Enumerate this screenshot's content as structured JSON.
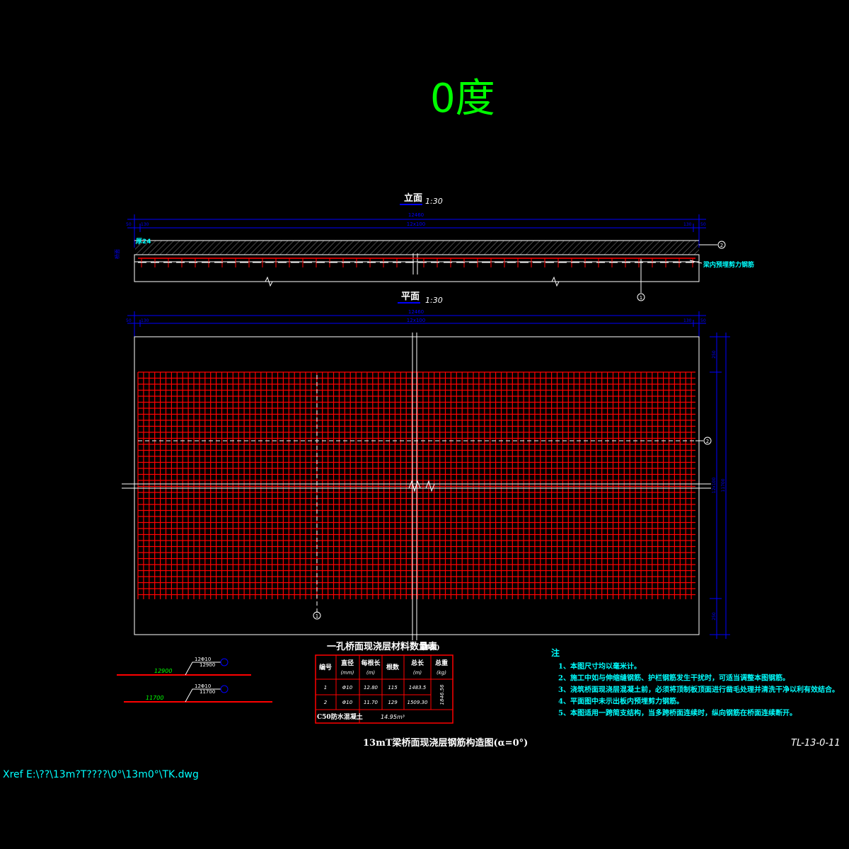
{
  "title": "0度",
  "elevation": {
    "label": "立面",
    "scale": "1:30",
    "dim_total": "12460",
    "dim_left": "50",
    "dim_left2": "130",
    "dim_mid": "12x100",
    "dim_right2": "130",
    "dim_right": "50",
    "thickness_label": "厚24",
    "side_label": "桥面",
    "rebar_note": "梁内预埋剪力钢筋",
    "marker1": "1",
    "marker2": "2"
  },
  "plan": {
    "label": "平面",
    "scale": "1:30",
    "dim_total": "12460",
    "dim_left": "50",
    "dim_left2": "130",
    "dim_mid": "12x100",
    "dim_right2": "130",
    "dim_right": "50",
    "dim_v_top": "250",
    "dim_v_mid": "12x100",
    "dim_v_mid2": "11700",
    "dim_v_bot": "250",
    "marker1": "1",
    "marker2": "2"
  },
  "bars": {
    "bar2_length": "12900",
    "bar2_text_a": "12Φ10",
    "bar2_text_b": "12900",
    "bar1_length": "11700",
    "bar1_text_a": "12Φ10",
    "bar1_text_b": "11700"
  },
  "table": {
    "title": "一孔桥面现浇层材料数量表",
    "title_note": "(单幅)",
    "headers": [
      "编号",
      "直径\n(mm)",
      "每根长\n(m)",
      "根数",
      "总长\n(m)",
      "总重\n(kg)"
    ],
    "rows": [
      [
        "1",
        "Φ10",
        "12.80",
        "115",
        "1483.5"
      ],
      [
        "2",
        "Φ10",
        "11.70",
        "129",
        "1509.30"
      ]
    ],
    "total_weight": "1846.56",
    "concrete_label": "C50防水混凝土",
    "concrete_value": "14.95m³"
  },
  "notes": {
    "heading": "注",
    "items": [
      "1、本图尺寸均以毫米计。",
      "2、施工中如与伸缩缝钢筋、护栏钢筋发生干扰时，可适当调整本图钢筋。",
      "3、浇筑桥面现浇层混凝土前，必须将顶制板顶面进行凿毛处理并清洗干净以利有效结合。",
      "4、平面图中未示出板内预埋剪力钢筋。",
      "5、本图适用一跨简支结构，当多跨桥面连续时，纵向钢筋在桥面连续断开。"
    ]
  },
  "drawing_title": "13mT梁桥面现浇层钢筋构造图(α=0°)",
  "drawing_number": "TL-13-0-11",
  "xref": "Xref E:\\??\\13m?T????\\0°\\13m0°\\TK.dwg",
  "colors": {
    "background": "#000000",
    "green": "#00ff00",
    "cyan": "#00ffff",
    "blue": "#0000ff",
    "red": "#ff0000",
    "white": "#ffffff",
    "yellow": "#ffff00",
    "grey": "#888888"
  }
}
